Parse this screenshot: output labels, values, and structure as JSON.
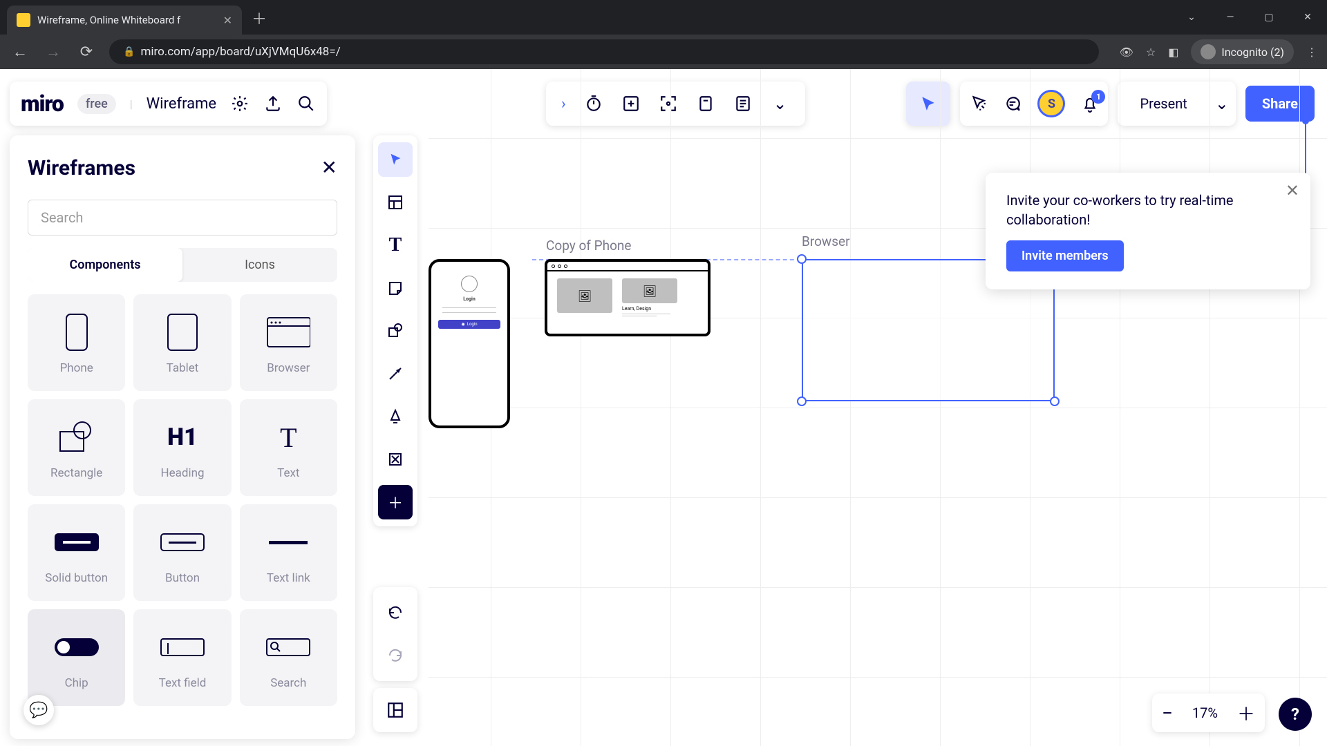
{
  "browser": {
    "tab_title": "Wireframe, Online Whiteboard f",
    "url": "miro.com/app/board/uXjVMqU6x48=/",
    "incognito_label": "Incognito (2)"
  },
  "header": {
    "logo": "miro",
    "badge": "free",
    "board_name": "Wireframe",
    "present": "Present",
    "share": "Share",
    "avatar_letter": "S",
    "bell_count": "1"
  },
  "sidebar": {
    "title": "Wireframes",
    "search_placeholder": "Search",
    "tabs": {
      "components": "Components",
      "icons": "Icons"
    },
    "items": [
      {
        "label": "Phone"
      },
      {
        "label": "Tablet"
      },
      {
        "label": "Browser"
      },
      {
        "label": "Rectangle"
      },
      {
        "label": "Heading"
      },
      {
        "label": "Text"
      },
      {
        "label": "Solid button"
      },
      {
        "label": "Button"
      },
      {
        "label": "Text link"
      },
      {
        "label": "Chip"
      },
      {
        "label": "Text field"
      },
      {
        "label": "Search"
      }
    ]
  },
  "canvas": {
    "label_phone": "Copy of Phone",
    "label_browser": "Browser",
    "phone_login_title": "Login",
    "phone_login_btn": "Login",
    "card_text": "Learn, Design"
  },
  "invite": {
    "text": "Invite your co-workers to try real-time collaboration!",
    "button": "Invite members"
  },
  "zoom": {
    "value": "17%"
  }
}
